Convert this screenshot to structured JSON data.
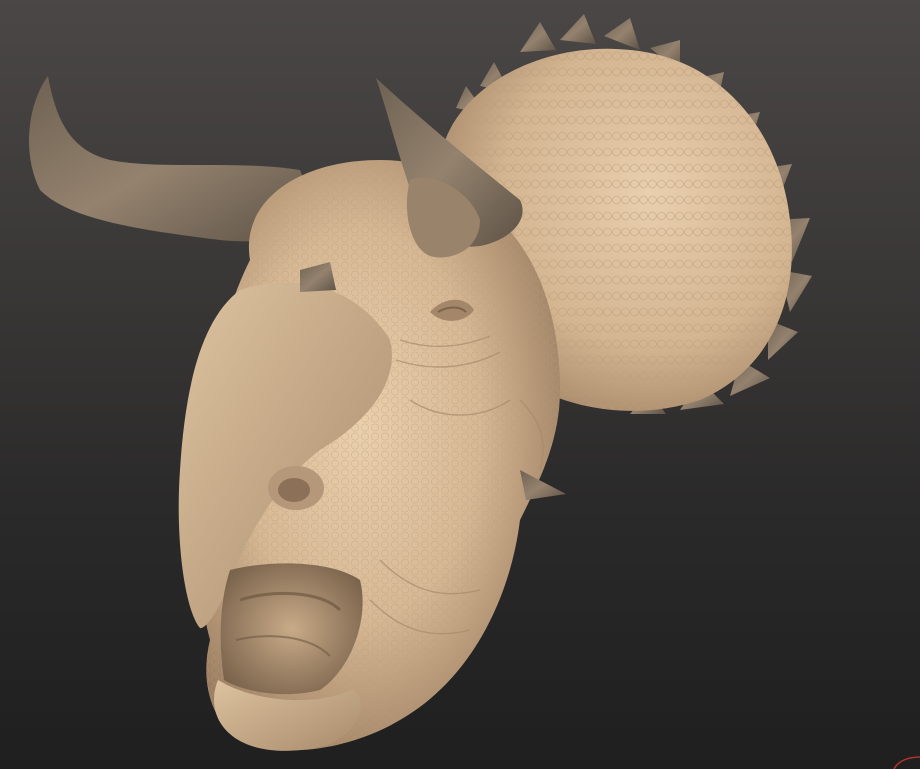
{
  "viewport": {
    "model_name": "",
    "material_color": "#d7b894",
    "horn_color": "#8a7a68",
    "background_top": "#4a4746",
    "background_bottom": "#1f1f1f"
  },
  "icons": {
    "corner_mark": "axis-corner-icon"
  }
}
